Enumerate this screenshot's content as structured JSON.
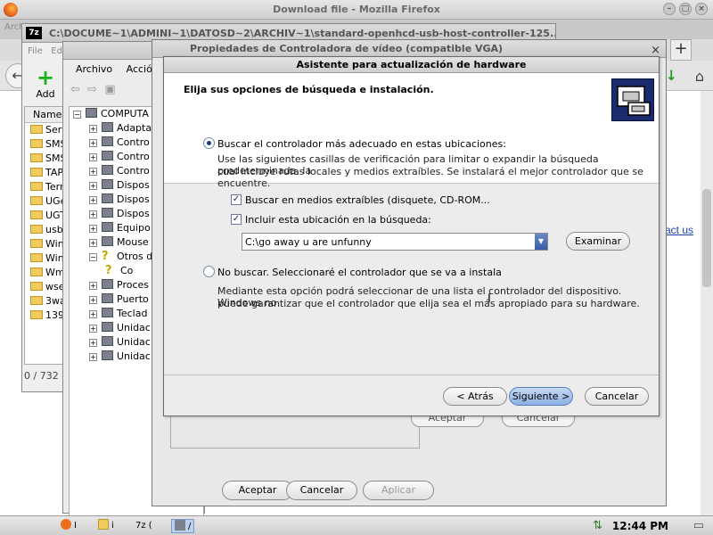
{
  "firefox": {
    "title": "Download file - Mozilla Firefox",
    "tab_partial": "Archiv",
    "contact_link": "ntact us"
  },
  "zip": {
    "title": "C:\\DOCUME~1\\ADMINI~1\\DATOSD~2\\ARCHIV~1\\standard-openhcd-usb-host-controller-125...",
    "icon_text": "7z",
    "menu": [
      "File",
      "Ed"
    ],
    "add_label": "Add",
    "column_name": "Name",
    "rows": [
      "Serv",
      "SMS",
      "SMS",
      "TAP",
      "Tern",
      "UGe",
      "UGT",
      "usb",
      "Win",
      "Win",
      "Wm",
      "wse",
      "3wa",
      "139"
    ],
    "status": "0 / 732 o"
  },
  "devmgr": {
    "menu": [
      "Archivo",
      "Acció"
    ],
    "root": "COMPUTA",
    "items": [
      {
        "label": "Adapta",
        "sign": "+"
      },
      {
        "label": "Contro",
        "sign": "+"
      },
      {
        "label": "Contro",
        "sign": "+"
      },
      {
        "label": "Contro",
        "sign": "+"
      },
      {
        "label": "Dispos",
        "sign": "+"
      },
      {
        "label": "Dispos",
        "sign": "+"
      },
      {
        "label": "Dispos",
        "sign": "+"
      },
      {
        "label": "Equipo",
        "sign": "+"
      },
      {
        "label": "Mouse",
        "sign": "+"
      },
      {
        "label": "Otros d",
        "sign": "−"
      },
      {
        "label": "Co",
        "sign": ""
      },
      {
        "label": "Proces",
        "sign": "+"
      },
      {
        "label": "Puerto",
        "sign": "+"
      },
      {
        "label": "Teclad",
        "sign": "+"
      },
      {
        "label": "Unidac",
        "sign": "+"
      },
      {
        "label": "Unidac",
        "sign": "+"
      },
      {
        "label": "Unidac",
        "sign": "+"
      }
    ]
  },
  "props": {
    "title": "Propiedades de Controladora de vídeo (compatible VGA)",
    "close": "×",
    "tab_ok": "Aceptar",
    "tab_cancel": "Cancelar",
    "btn_accept": "Aceptar",
    "btn_cancel": "Cancelar",
    "btn_apply": "Aplicar"
  },
  "wizard": {
    "title": "Asistente para actualización de hardware",
    "heading": "Elija sus opciones de búsqueda e instalación.",
    "option1": "Buscar el controlador más adecuado en estas ubicaciones:",
    "option1_desc_1": "Use las siguientes casillas de verificación para limitar o expandir la búsqueda predeterminada, la",
    "option1_desc_2": "cual incluye rutas locales y medios extraíbles. Se instalará el mejor controlador que se encuentre.",
    "check1": "Buscar en medios extraíbles (disquete, CD-ROM...",
    "check2": "Incluir esta ubicación en la búsqueda:",
    "path_value": "C:\\go away u are unfunny",
    "browse": "Examinar",
    "option2": "No buscar. Seleccionaré el controlador que se va a instala",
    "option2_desc_1": "Mediante esta opción podrá seleccionar de una lista el controlador del dispositivo. Windows no",
    "option2_desc_2": "puede garantizar que el controlador que elija sea el más apropiado para su hardware.",
    "back": "< Atrás",
    "next": "Siguiente >",
    "cancel": "Cancelar"
  },
  "taskbar": {
    "items": [
      "I",
      "i",
      "7z (",
      "/"
    ],
    "clock": "12:44 PM"
  }
}
